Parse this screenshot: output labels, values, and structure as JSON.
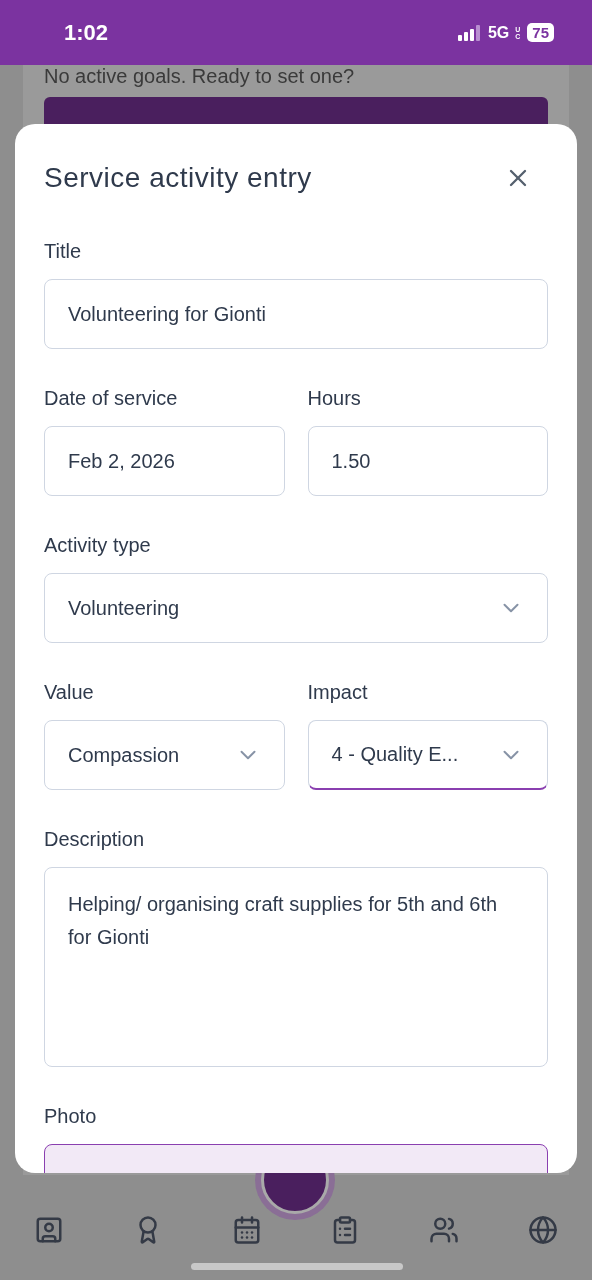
{
  "status_bar": {
    "time": "1:02",
    "network": "5G",
    "network_sub": "UC",
    "battery": "75"
  },
  "background": {
    "message": "No active goals. Ready to set one?"
  },
  "modal": {
    "title": "Service activity entry",
    "rows": [
      [
        {
          "kind": "text",
          "label": "Title",
          "value": "Volunteering for Gionti",
          "focused": false
        }
      ],
      [
        {
          "kind": "text",
          "label": "Date of service",
          "value": "Feb 2, 2026",
          "focused": false
        },
        {
          "kind": "text",
          "label": "Hours",
          "value": "1.50",
          "focused": false
        }
      ],
      [
        {
          "kind": "select",
          "label": "Activity type",
          "value": "Volunteering",
          "focused": false
        }
      ],
      [
        {
          "kind": "select",
          "label": "Value",
          "value": "Compassion",
          "focused": false
        },
        {
          "kind": "select",
          "label": "Impact",
          "value": "4 - Quality E...",
          "focused": true
        }
      ],
      [
        {
          "kind": "textarea",
          "label": "Description",
          "value": "Helping/ organising craft supplies for 5th and 6th for Gionti",
          "focused": false
        }
      ],
      [
        {
          "kind": "photo",
          "label": "Photo",
          "focused": false
        }
      ]
    ]
  },
  "nav": {
    "items": [
      {
        "kind": "profile"
      },
      {
        "kind": "award"
      },
      {
        "kind": "calendar"
      },
      {
        "kind": "clipboard"
      },
      {
        "kind": "people"
      },
      {
        "kind": "globe"
      }
    ]
  }
}
